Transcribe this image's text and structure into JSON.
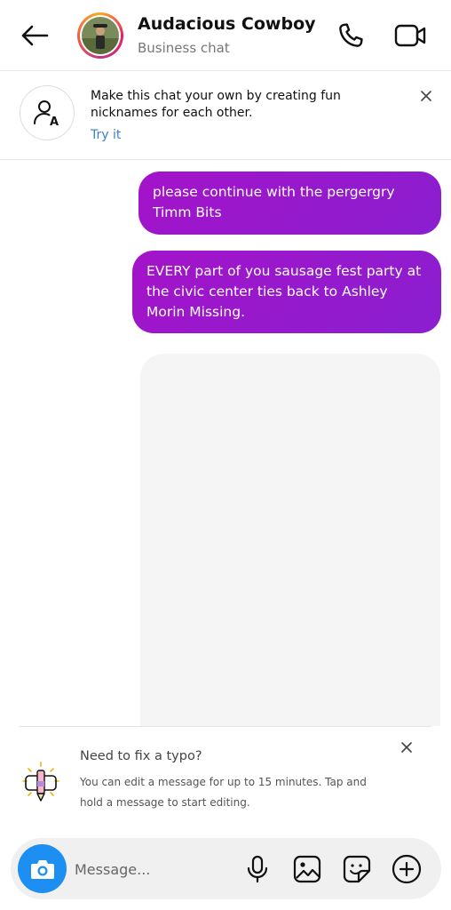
{
  "header": {
    "title": "Audacious Cowboy",
    "subtitle": "Business chat",
    "back_icon": "arrow-left-icon",
    "call_icon": "phone-icon",
    "video_icon": "video-camera-icon"
  },
  "nickname_banner": {
    "text": "Make this chat your own by creating fun nicknames for each other.",
    "action": "Try it",
    "icon": "person-nickname-icon",
    "close_icon": "close-icon"
  },
  "messages": [
    {
      "text": "please continue with the pergergry Timm Bits"
    },
    {
      "text": "EVERY part of you sausage fest party at the civic center ties back to Ashley Morin Missing."
    }
  ],
  "typo_tip": {
    "title": "Need to fix a typo?",
    "body": "You can edit a message for up to 15 minutes. Tap and hold a message to start editing.",
    "icon": "edit-pencil-bubble-icon",
    "close_icon": "close-icon"
  },
  "composer": {
    "placeholder": "Message...",
    "icons": [
      "camera-icon",
      "microphone-icon",
      "gallery-icon",
      "sticker-icon",
      "plus-icon"
    ]
  },
  "colors": {
    "bubble_start": "#a413c9",
    "bubble_end": "#8a1fd0",
    "link": "#3b82c4",
    "camera_button": "#1d8ff2"
  }
}
